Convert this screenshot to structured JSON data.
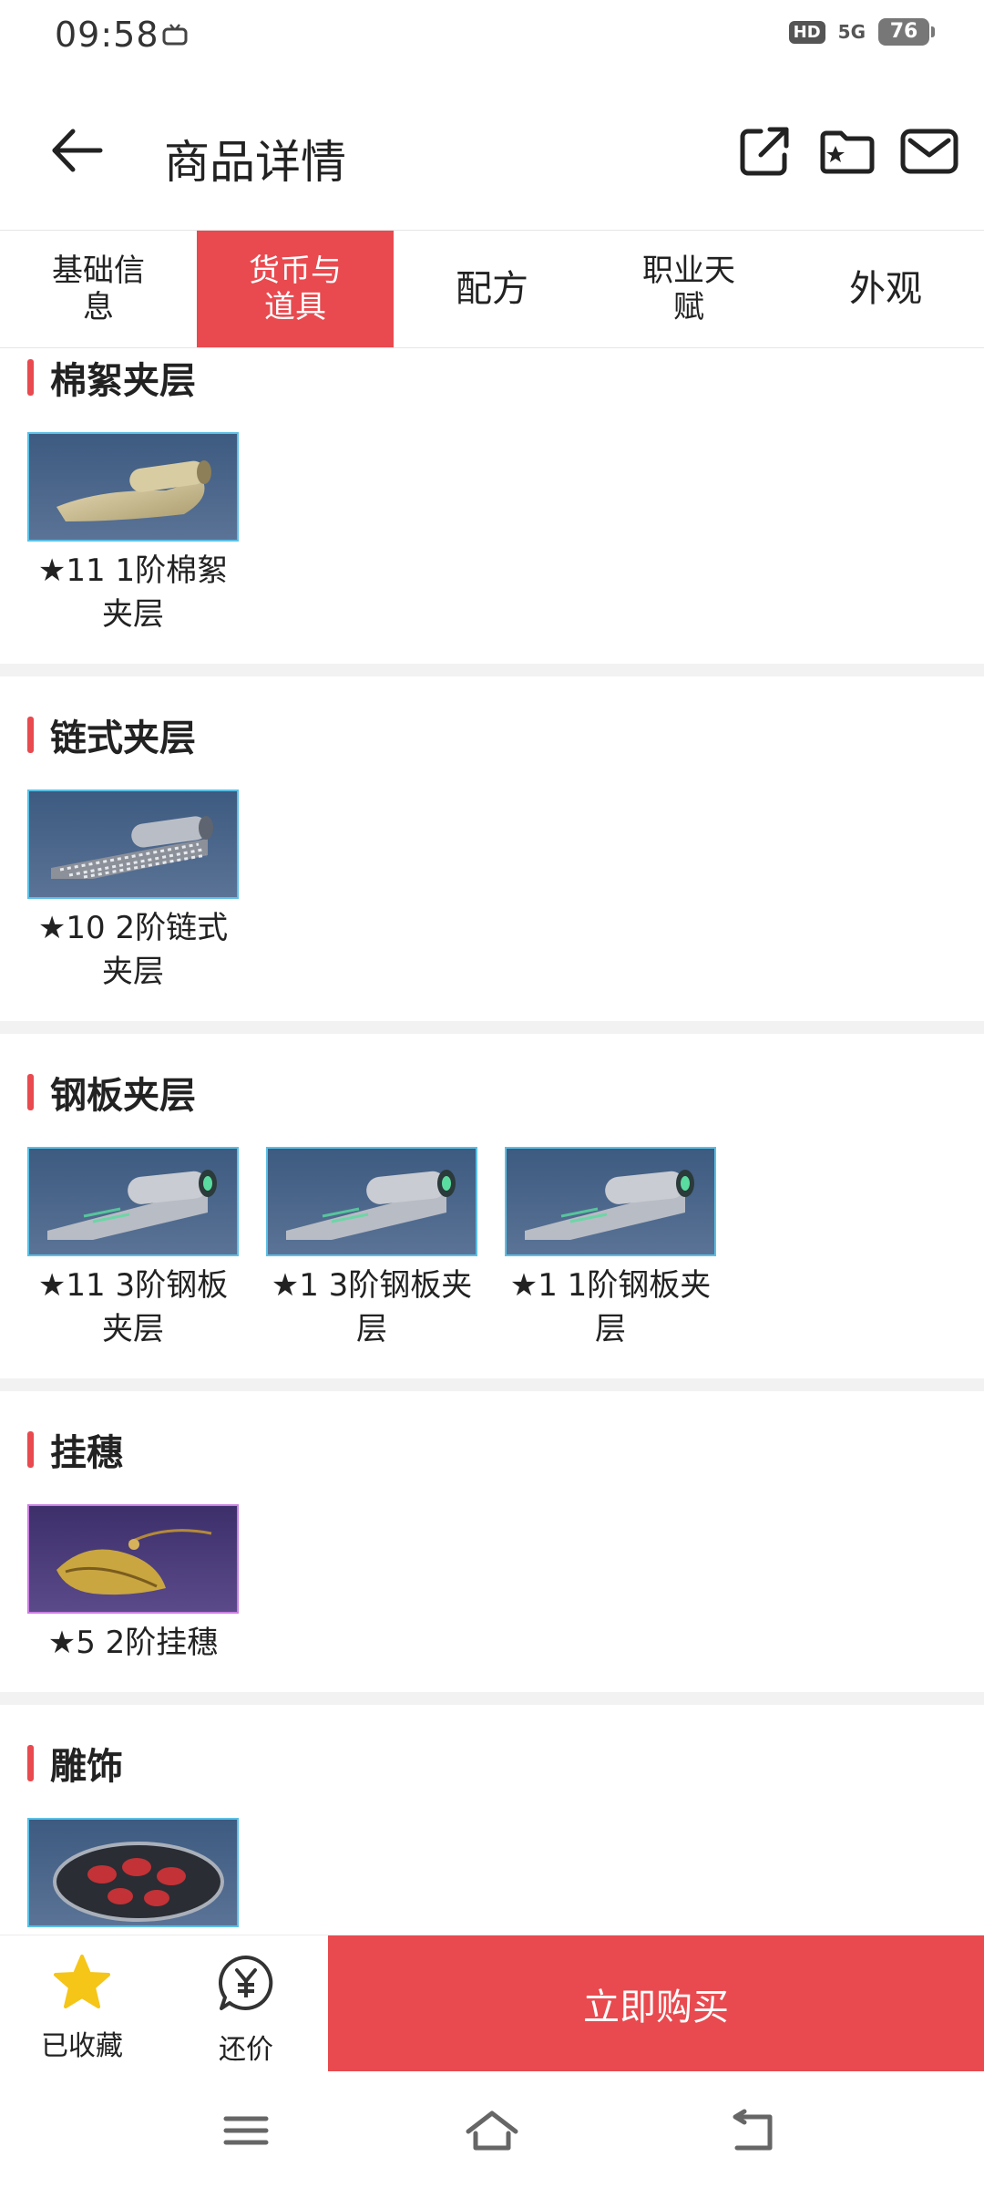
{
  "status_bar": {
    "time": "09:58",
    "hd": "HD",
    "network": "5G",
    "battery": "76"
  },
  "header": {
    "title": "商品详情"
  },
  "tabs": [
    {
      "label": "基础信\n息",
      "active": false
    },
    {
      "label": "货币与\n道具",
      "active": true
    },
    {
      "label": "配方",
      "active": false
    },
    {
      "label": "职业天\n赋",
      "active": false
    },
    {
      "label": "外观",
      "active": false
    }
  ],
  "sections": [
    {
      "title": "棉絮夹层",
      "items": [
        {
          "label": "★11 1阶棉絮\n夹层",
          "icon": "cotton-roll-icon"
        }
      ]
    },
    {
      "title": "链式夹层",
      "items": [
        {
          "label": "★10 2阶链式\n夹层",
          "icon": "chain-roll-icon"
        }
      ]
    },
    {
      "title": "钢板夹层",
      "items": [
        {
          "label": "★11 3阶钢板\n夹层",
          "icon": "steel-roll-icon"
        },
        {
          "label": "★1 3阶钢板夹\n层",
          "icon": "steel-roll-icon"
        },
        {
          "label": "★1 1阶钢板夹\n层",
          "icon": "steel-roll-icon"
        }
      ]
    },
    {
      "title": "挂穗",
      "items": [
        {
          "label": "★5 2阶挂穗",
          "icon": "tassel-icon"
        }
      ]
    },
    {
      "title": "雕饰",
      "items": [
        {
          "label": "",
          "icon": "carving-icon"
        }
      ]
    }
  ],
  "bottom_bar": {
    "favorite_label": "已收藏",
    "bargain_label": "还价",
    "buy_label": "立即购买"
  },
  "colors": {
    "accent": "#e84a4f",
    "item_border_blue": "#5ac0e6",
    "item_border_purple": "#c97ee0",
    "favorite_star": "#f5c518"
  }
}
